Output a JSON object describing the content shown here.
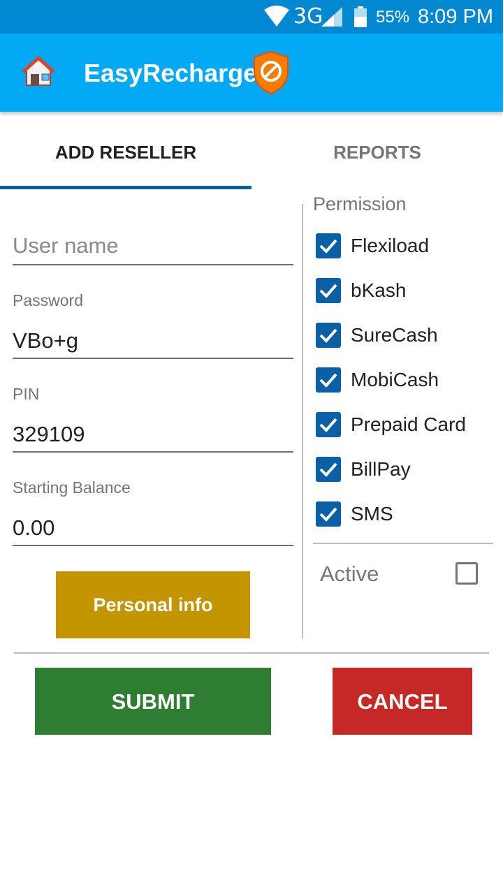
{
  "status_bar": {
    "network": "3G",
    "battery": "55%",
    "time": "8:09 PM"
  },
  "app": {
    "title": "EasyRecharge",
    "accent": "#03a9f4"
  },
  "tabs": [
    {
      "label": "ADD RESELLER",
      "selected": true
    },
    {
      "label": "REPORTS",
      "selected": false
    }
  ],
  "form": {
    "username": {
      "placeholder": "User name",
      "value": ""
    },
    "password": {
      "label": "Password",
      "value": "VBo+g"
    },
    "pin": {
      "label": "PIN",
      "value": "329109"
    },
    "balance": {
      "label": "Starting Balance",
      "value": "0.00"
    },
    "personal_info_label": "Personal info"
  },
  "permissions": {
    "title": "Permission",
    "items": [
      {
        "label": "Flexiload",
        "checked": true
      },
      {
        "label": "bKash",
        "checked": true
      },
      {
        "label": "SureCash",
        "checked": true
      },
      {
        "label": "MobiCash",
        "checked": true
      },
      {
        "label": "Prepaid Card",
        "checked": true
      },
      {
        "label": "BillPay",
        "checked": true
      },
      {
        "label": "SMS",
        "checked": true
      }
    ],
    "active_label": "Active",
    "active_checked": false
  },
  "actions": {
    "submit_label": "SUBMIT",
    "cancel_label": "CANCEL"
  },
  "colors": {
    "submit": "#2e7d32",
    "cancel": "#c62828",
    "personal_info": "#c39500",
    "checkbox": "#0b5fa5"
  }
}
